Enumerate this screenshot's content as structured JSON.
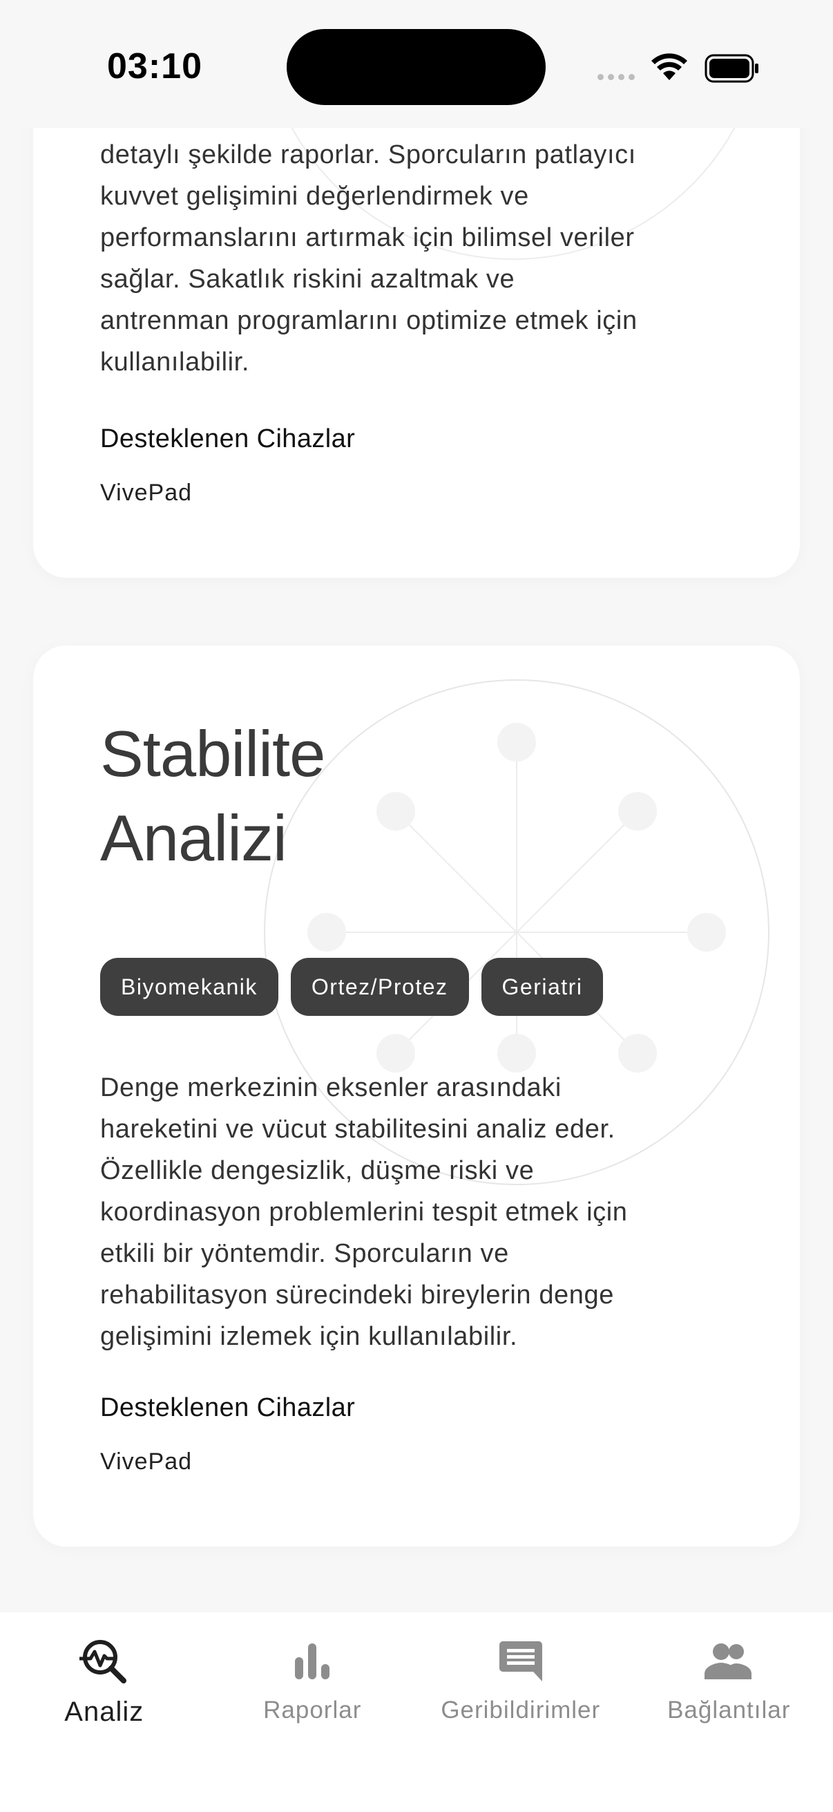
{
  "status_bar": {
    "time": "03:10"
  },
  "cards": [
    {
      "description_lines": [
        "detaylı şekilde raporlar. Sporcuların patlayıcı",
        "kuvvet gelişimini değerlendirmek ve",
        "performanslarını artırmak için bilimsel veriler",
        "sağlar. Sakatlık riskini azaltmak ve",
        "antrenman programlarını optimize etmek için",
        "kullanılabilir."
      ],
      "supported_title": "Desteklenen Cihazlar",
      "device": "VivePad"
    },
    {
      "title_lines": [
        "Stabilite",
        "Analizi"
      ],
      "tags": [
        "Biyomekanik",
        "Ortez/Protez",
        "Geriatri"
      ],
      "description_lines": [
        "Denge merkezinin eksenler arasındaki",
        "hareketini ve vücut stabilitesini analiz eder.",
        "Özellikle dengesizlik, düşme riski ve",
        "koordinasyon problemlerini tespit etmek için",
        "etkili bir yöntemdir. Sporcuların ve",
        "rehabilitasyon sürecindeki bireylerin denge",
        "gelişimini izlemek için kullanılabilir."
      ],
      "supported_title": "Desteklenen Cihazlar",
      "device": "VivePad"
    }
  ],
  "tab_bar": {
    "tabs": [
      {
        "label": "Analiz",
        "icon": "analysis-search-icon",
        "active": true
      },
      {
        "label": "Raporlar",
        "icon": "bar-chart-icon",
        "active": false
      },
      {
        "label": "Geribildirimler",
        "icon": "feedback-icon",
        "active": false
      },
      {
        "label": "Bağlantılar",
        "icon": "people-icon",
        "active": false
      }
    ]
  },
  "colors": {
    "background": "#f7f7f7",
    "card": "#ffffff",
    "tag": "#3f3f3f",
    "active_tab": "#1f1f1f",
    "inactive_tab": "#8d8d8d"
  }
}
